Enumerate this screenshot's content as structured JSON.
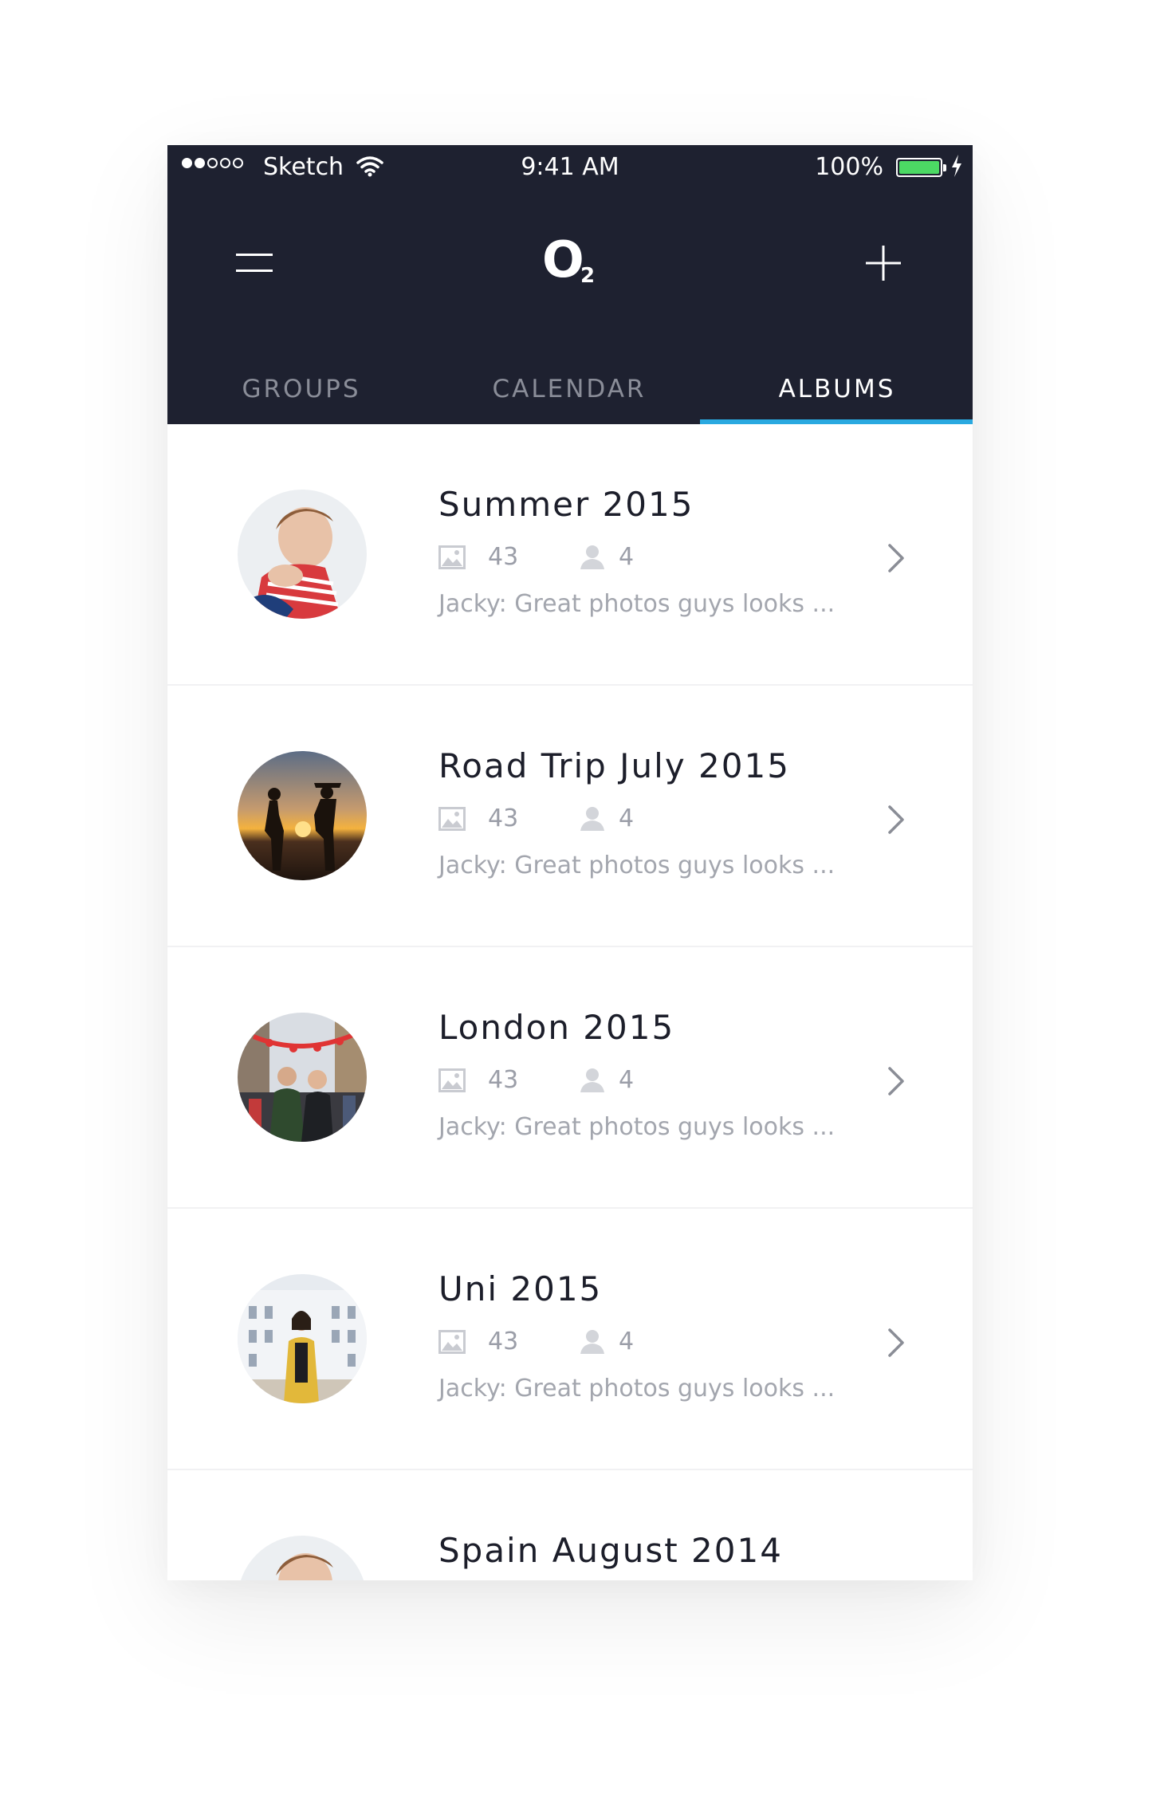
{
  "status_bar": {
    "carrier": "Sketch",
    "time": "9:41 AM",
    "battery": "100%",
    "signal_bars_filled": 2,
    "signal_bars_total": 5
  },
  "header": {
    "logo_letter": "O",
    "logo_subscript": "2",
    "menu_icon": "hamburger-menu-icon",
    "add_icon": "plus-icon"
  },
  "tabs": [
    {
      "label": "GROUPS",
      "active": false
    },
    {
      "label": "CALENDAR",
      "active": false
    },
    {
      "label": "ALBUMS",
      "active": true
    }
  ],
  "colors": {
    "header_bg": "#1e2130",
    "accent": "#2aa9e0",
    "battery": "#4cd964"
  },
  "albums": [
    {
      "title": "Summer 2015",
      "photos": "43",
      "members": "4",
      "preview": "Jacky: Great photos guys looks ..."
    },
    {
      "title": "Road Trip July 2015",
      "photos": "43",
      "members": "4",
      "preview": "Jacky: Great photos guys looks ..."
    },
    {
      "title": "London 2015",
      "photos": "43",
      "members": "4",
      "preview": "Jacky: Great photos guys looks ..."
    },
    {
      "title": "Uni 2015",
      "photos": "43",
      "members": "4",
      "preview": "Jacky: Great photos guys looks ..."
    },
    {
      "title": "Spain August 2014",
      "photos": "",
      "members": "",
      "preview": ""
    }
  ]
}
